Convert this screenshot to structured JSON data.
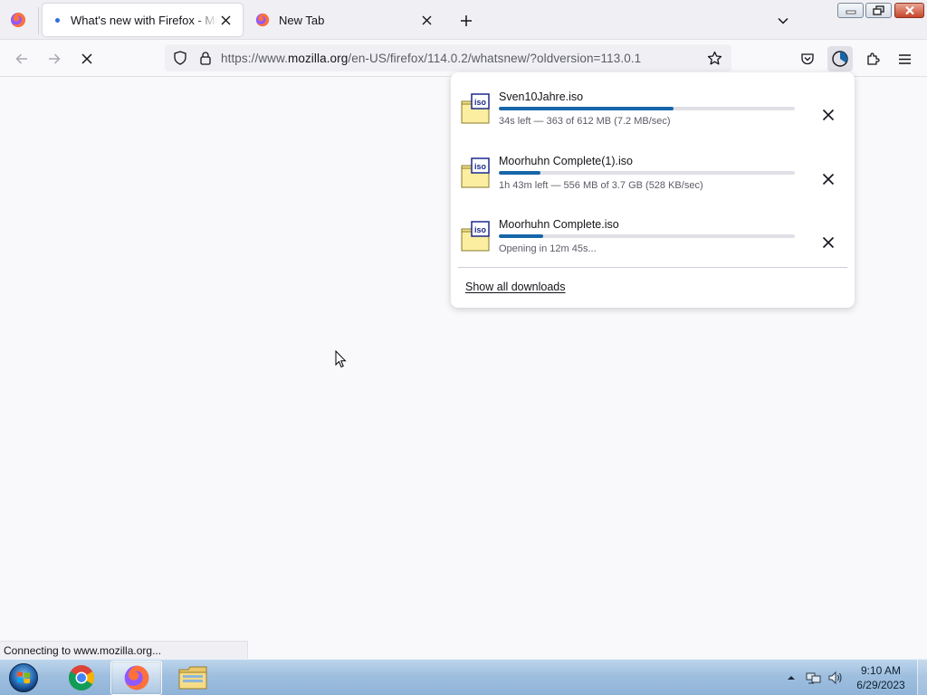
{
  "tabs": [
    {
      "title": "What's new with Firefox - More",
      "active": true
    },
    {
      "title": "New Tab",
      "active": false
    }
  ],
  "navbar": {
    "url_prefix": "https://www.",
    "url_host": "mozilla.org",
    "url_path": "/en-US/firefox/114.0.2/whatsnew/?oldversion=113.0.1"
  },
  "downloads": {
    "items": [
      {
        "name": "Sven10Jahre.iso",
        "status": "34s left — 363 of 612 MB (7.2 MB/sec)",
        "progress": 0.59,
        "icon_label": "iso"
      },
      {
        "name": "Moorhuhn Complete(1).iso",
        "status": "1h 43m left — 556 MB of 3.7 GB (528 KB/sec)",
        "progress": 0.14,
        "icon_label": "iso"
      },
      {
        "name": "Moorhuhn Complete.iso",
        "status": "Opening in 12m 45s...",
        "progress": 0.15,
        "icon_label": "iso"
      }
    ],
    "show_all": "Show all downloads"
  },
  "status_bar": {
    "text": "Connecting to www.mozilla.org..."
  },
  "taskbar": {
    "time": "9:10 AM",
    "date": "6/29/2023"
  },
  "colors": {
    "accent": "#1566a8",
    "firefox_orange": "#ff7139",
    "firefox_purple": "#9059ff"
  },
  "icons": {
    "app": "firefox-icon",
    "back": "arrow-left-icon",
    "forward": "arrow-right-icon",
    "stop": "close-icon",
    "shield": "shield-icon",
    "lock": "lock-icon",
    "bookmark": "star-icon",
    "pocket": "pocket-icon",
    "downloads": "download-progress-icon",
    "extensions": "puzzle-icon",
    "menu": "hamburger-icon"
  }
}
